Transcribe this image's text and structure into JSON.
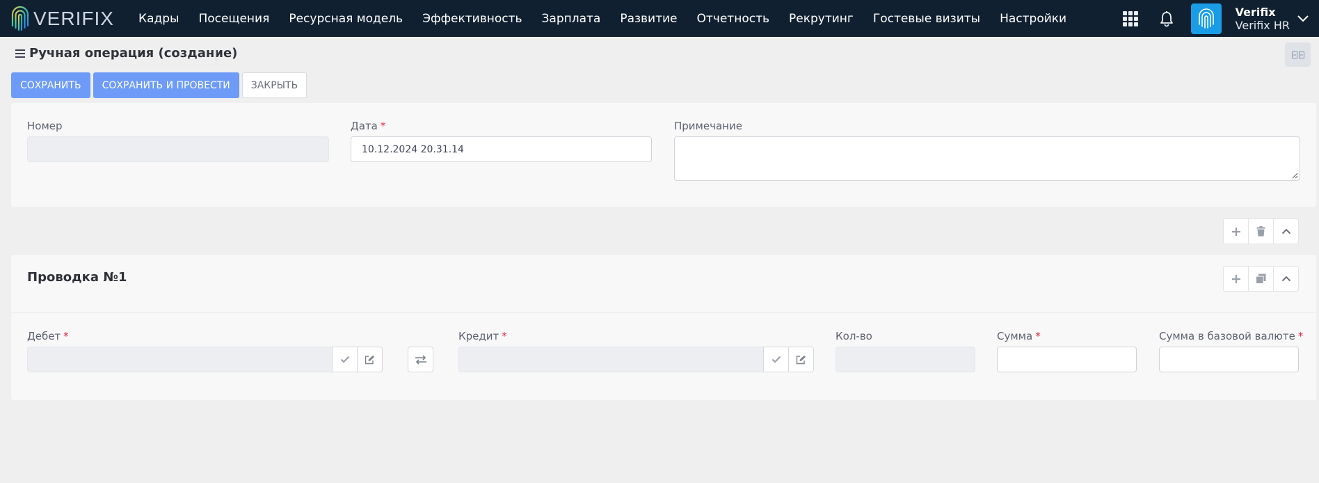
{
  "brand": {
    "logo_text": "VERIFIX"
  },
  "nav": {
    "items": [
      "Кадры",
      "Посещения",
      "Ресурсная модель",
      "Эффективность",
      "Зарплата",
      "Развитие",
      "Отчетность",
      "Рекрутинг",
      "Гостевые визиты",
      "Настройки"
    ]
  },
  "user": {
    "name": "Verifix",
    "org": "Verifix HR"
  },
  "page": {
    "title": "Ручная операция (создание)"
  },
  "toolbar": {
    "save_label": "СОХРАНИТЬ",
    "save_post_label": "СОХРАНИТЬ И ПРОВЕСТИ",
    "close_label": "ЗАКРЫТЬ"
  },
  "header_form": {
    "number_label": "Номер",
    "number_value": "",
    "date_label": "Дата",
    "date_value": "10.12.2024 20.31.14",
    "note_label": "Примечание",
    "note_value": ""
  },
  "required_mark": "*",
  "entry": {
    "title": "Проводка №1",
    "debit_label": "Дебет",
    "debit_value": "",
    "credit_label": "Кредит",
    "credit_value": "",
    "qty_label": "Кол-во",
    "qty_value": "",
    "sum_label": "Сумма",
    "sum_value": "",
    "base_sum_label": "Сумма в базовой валюте",
    "base_sum_value": ""
  },
  "colors": {
    "nav_bg": "#102031",
    "primary": "#6d9bf7",
    "required": "#e2263b",
    "badge": "#1a9ce6"
  }
}
